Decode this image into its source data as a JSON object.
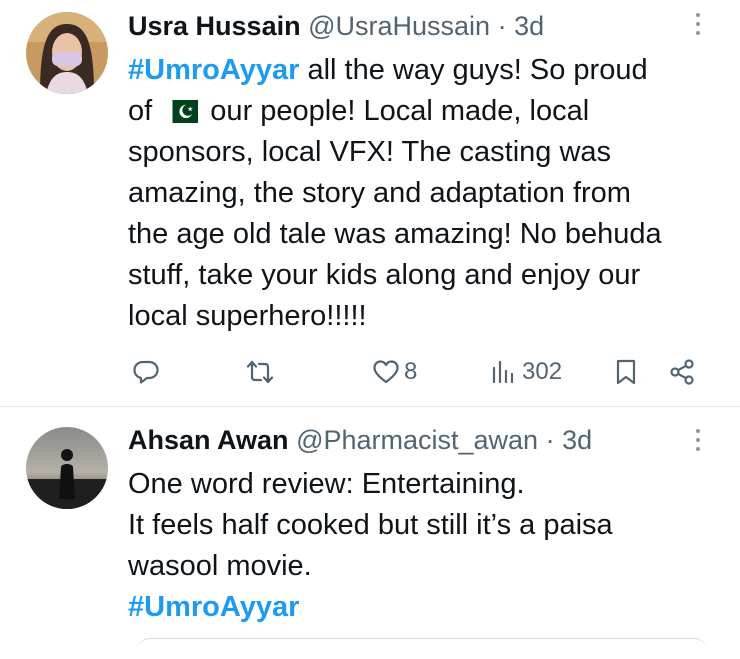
{
  "tweets": [
    {
      "name": "Usra Hussain",
      "handle": "@UsraHussain",
      "separator": "·",
      "time": "3d",
      "hashtag": "#UmroAyyar",
      "text_part1": " all the way guys! So proud",
      "text_part2": "of ",
      "text_part3": " our people! Local made, local",
      "text_lines": [
        "sponsors, local VFX! The casting was",
        "amazing, the story and adaptation from",
        "the age old tale was amazing! No behuda",
        "stuff, take your kids along and enjoy our",
        "local superhero!!!!!"
      ],
      "flag_icon": "pakistan-flag",
      "likes": "8",
      "views": "302"
    },
    {
      "name": "Ahsan Awan",
      "handle": "@Pharmacist_awan",
      "separator": "·",
      "time": "3d",
      "text_lines": [
        "One word review: Entertaining.",
        "It feels half cooked but still it’s a paisa",
        "wasool movie."
      ],
      "hashtag": "#UmroAyyar"
    }
  ],
  "icons": {
    "reply": "reply-icon",
    "retweet": "retweet-icon",
    "like": "heart-icon",
    "views": "views-icon",
    "bookmark": "bookmark-icon",
    "share": "share-icon",
    "more": "more-options-icon"
  },
  "colors": {
    "link": "#1d9bf0",
    "text": "#0f1419",
    "secondary": "#536471",
    "divider": "#e6ecf0"
  }
}
